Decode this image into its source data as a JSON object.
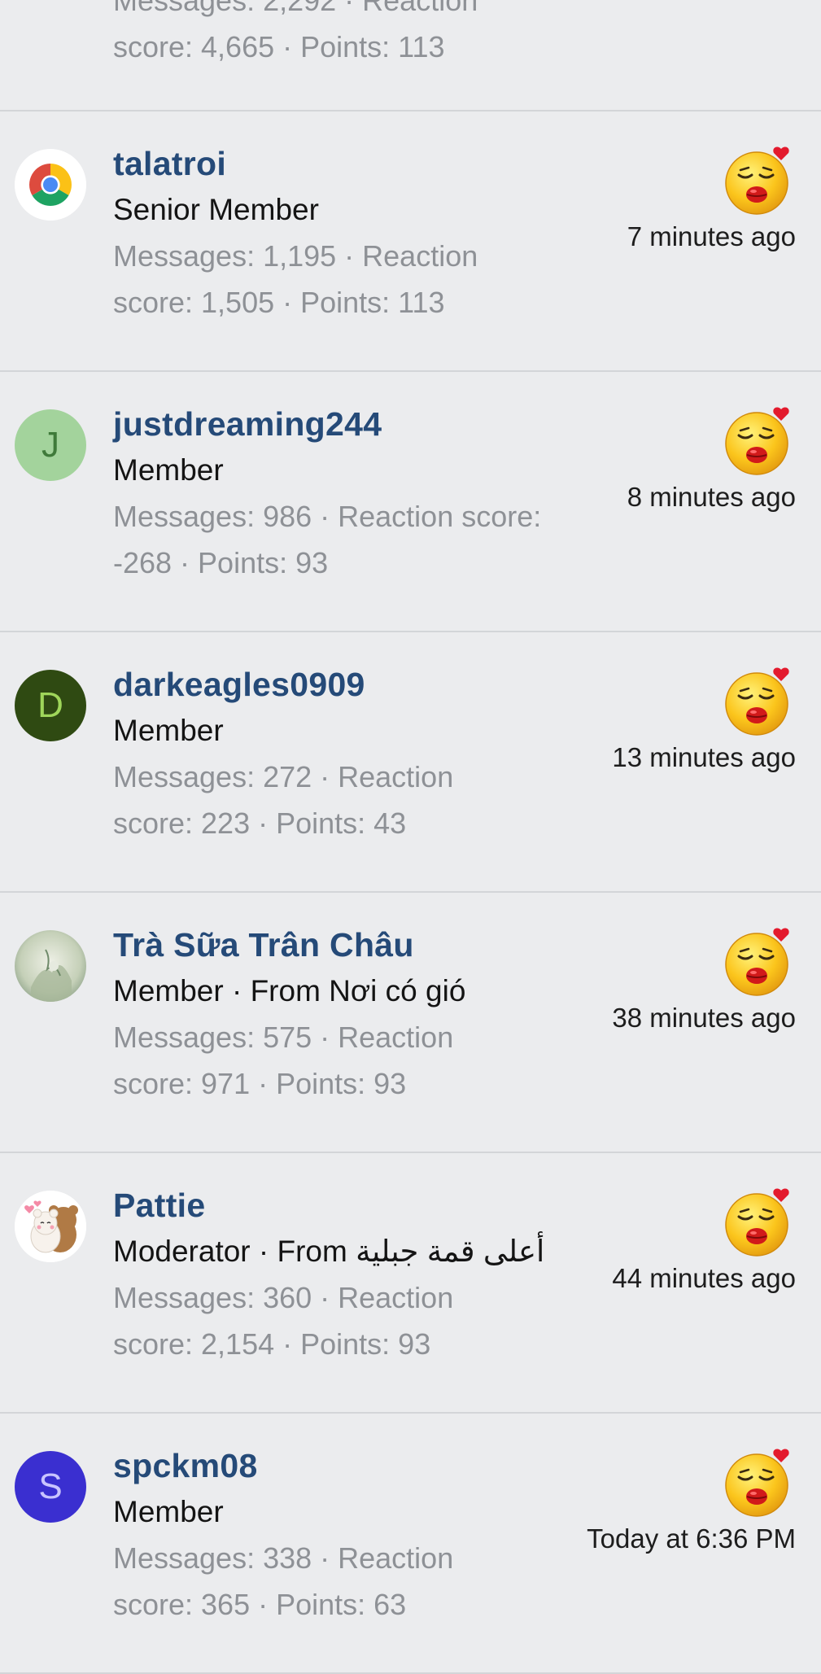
{
  "top_fragment": {
    "line1": "Messages: 2,292 · Reaction",
    "line2": "score: 4,665 · Points: 113"
  },
  "colors": {
    "username": "#254a78",
    "meta": "#8e9196",
    "background": "#ebecee",
    "divider": "#d3d5d8"
  },
  "members": [
    {
      "username": "talatroi",
      "role": "Senior Member",
      "meta_line1": "Messages: 1,195 · Reaction",
      "meta_line2": "score: 1,505 · Points: 113",
      "time": "7 minutes ago",
      "avatar": {
        "type": "icon",
        "icon": "chrome-icon"
      }
    },
    {
      "username": "justdreaming244",
      "role": "Member",
      "meta_line1": "Messages: 986 · Reaction score:",
      "meta_line2": "-268 · Points: 93",
      "time": "8 minutes ago",
      "avatar": {
        "type": "letter",
        "letter": "J",
        "bg": "#a3d39c",
        "fg": "#3f7a3a"
      }
    },
    {
      "username": "darkeagles0909",
      "role": "Member",
      "meta_line1": "Messages: 272 · Reaction",
      "meta_line2": "score: 223 · Points: 43",
      "time": "13 minutes ago",
      "avatar": {
        "type": "letter",
        "letter": "D",
        "bg": "#2f4a12",
        "fg": "#9fd65a"
      }
    },
    {
      "username": "Trà Sữa Trân Châu",
      "role": "Member · From Nơi có gió",
      "meta_line1": "Messages: 575 · Reaction",
      "meta_line2": "score: 971 · Points: 93",
      "time": "38 minutes ago",
      "avatar": {
        "type": "icon",
        "icon": "landscape-photo-icon"
      }
    },
    {
      "username": "Pattie",
      "role": "Moderator · From أعلى قمة جبلية",
      "meta_line1": "Messages: 360 · Reaction",
      "meta_line2": "score: 2,154 · Points: 93",
      "time": "44 minutes ago",
      "avatar": {
        "type": "icon",
        "icon": "bears-hug-icon"
      }
    },
    {
      "username": "spckm08",
      "role": "Member",
      "meta_line1": "Messages: 338 · Reaction",
      "meta_line2": "score: 365 · Points: 63",
      "time": "Today at 6:36 PM",
      "avatar": {
        "type": "letter",
        "letter": "S",
        "bg": "#3a2fd0",
        "fg": "#c9c4ff"
      }
    }
  ],
  "reaction_icon": "kiss-emoji-icon"
}
